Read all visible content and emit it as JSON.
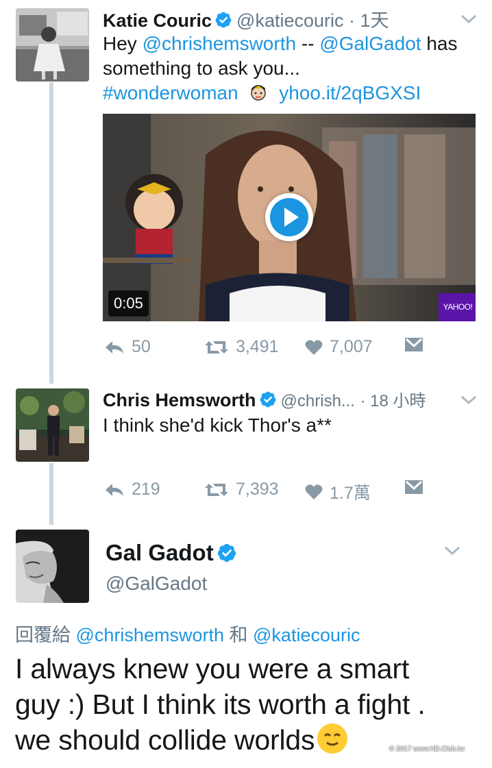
{
  "tweets": [
    {
      "name": "Katie Couric",
      "handle": "@katiecouric",
      "time": "· 1天",
      "text_hey": "Hey",
      "mention1": "@chrishemsworth",
      "dash": "--",
      "mention2": "@GalGadot",
      "text_has": "has",
      "text_line2": "something to ask you...",
      "hashtag": "#wonderwoman",
      "url": "yhoo.it/2qBGXSI",
      "video_duration": "0:05",
      "video_brand": "YAHOO!",
      "replies": "50",
      "retweets": "3,491",
      "likes": "7,007"
    },
    {
      "name": "Chris Hemsworth",
      "handle": "@chrish...",
      "time": "· 18 小時",
      "text": "I think she'd kick Thor's a**",
      "replies": "219",
      "retweets": "7,393",
      "likes": "1.7萬"
    },
    {
      "name": "Gal Gadot",
      "handle": "@GalGadot",
      "reply_prefix": "回覆給",
      "reply_to1": "@chrishemsworth",
      "reply_and": "和",
      "reply_to2": "@katiecouric",
      "text_line1": "I always knew you were a smart",
      "text_line2": "guy :) But I think its worth a fight .",
      "text_line3": "we should collide worlds"
    }
  ],
  "watermark": "© 2017 www.HD.Club.tw",
  "colors": {
    "link": "#1b95e0",
    "verified": "#1da1f2",
    "muted": "#8899a6",
    "thread_line": "#ccd6dd"
  },
  "icons": [
    "verified-badge-icon",
    "chevron-down-icon",
    "reply-icon",
    "retweet-icon",
    "like-icon",
    "direct-message-icon",
    "play-icon",
    "emoji-icon"
  ]
}
